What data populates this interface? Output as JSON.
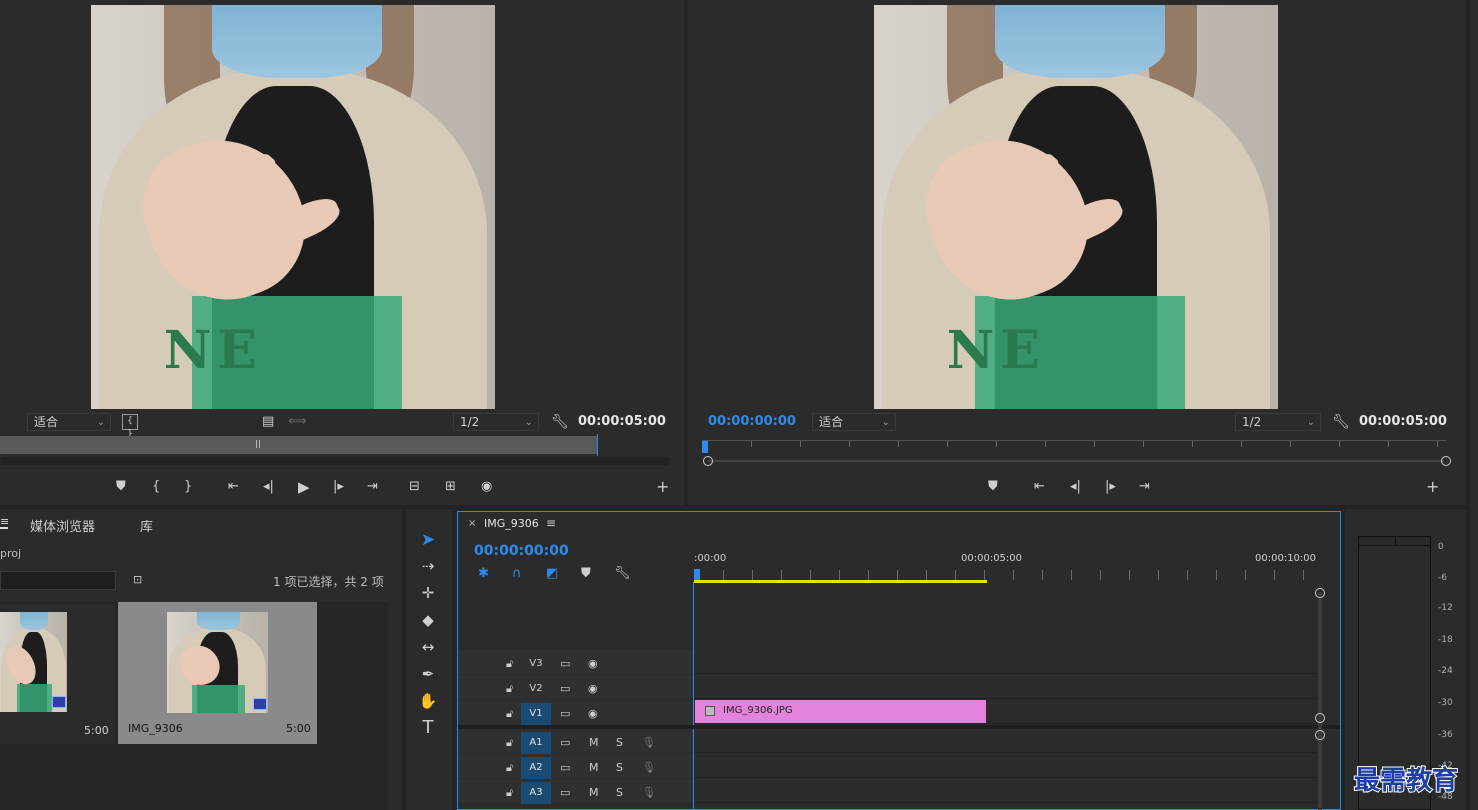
{
  "source_monitor": {
    "fit_option": "适合",
    "resolution": "1/2",
    "duration": "00:00:05:00"
  },
  "program_monitor": {
    "timecode": "00:00:00:00",
    "fit_option": "适合",
    "resolution": "1/2",
    "duration": "00:00:05:00"
  },
  "project_panel": {
    "tabs": [
      "媒体浏览器",
      "库"
    ],
    "project_name": "proj",
    "selection_status": "1 项已选择，共 2 项",
    "items": [
      {
        "name": "",
        "duration": "5:00",
        "selected": false
      },
      {
        "name": "IMG_9306",
        "duration": "5:00",
        "selected": true
      }
    ]
  },
  "timeline": {
    "sequence_name": "IMG_9306",
    "timecode": "00:00:00:00",
    "ruler_labels": [
      ":00:00",
      "00:00:05:00",
      "00:00:10:00"
    ],
    "video_tracks": [
      "V3",
      "V2",
      "V1"
    ],
    "audio_tracks": [
      "A1",
      "A2",
      "A3"
    ],
    "mute_label": "M",
    "solo_label": "S",
    "clip_name": "IMG_9306.JPG"
  },
  "audio_meter": {
    "db_labels": [
      "0",
      "-6",
      "-12",
      "-18",
      "-24",
      "-30",
      "-36",
      "-42",
      "-48"
    ]
  },
  "watermark": "最需教育"
}
